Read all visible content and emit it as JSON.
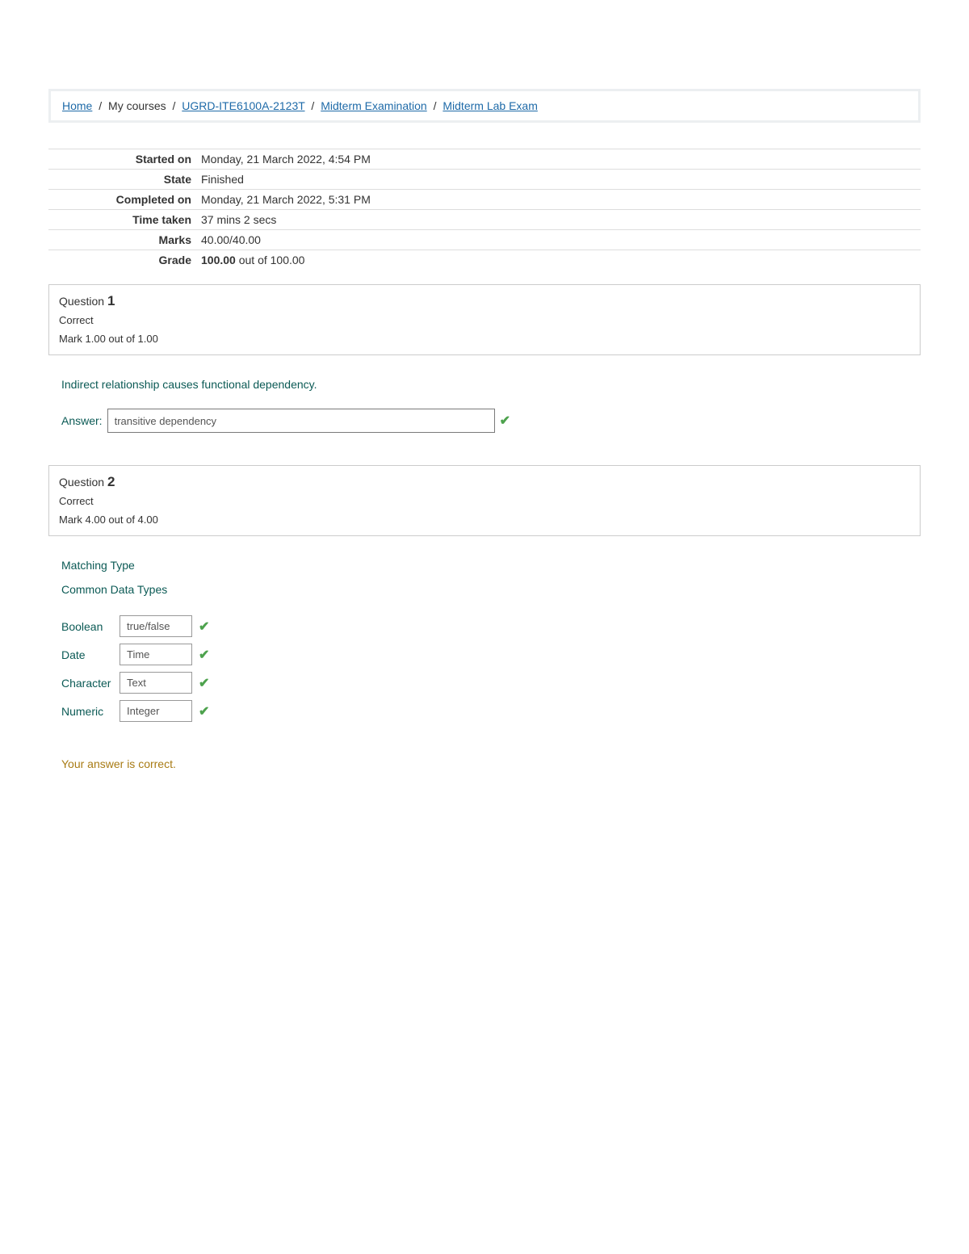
{
  "breadcrumb": {
    "home": "Home",
    "mycourses": "My courses",
    "course": "UGRD-ITE6100A-2123T",
    "section": "Midterm Examination",
    "activity": "Midterm Lab Exam"
  },
  "summary": {
    "started_on_label": "Started on",
    "started_on": "Monday, 21 March 2022, 4:54 PM",
    "state_label": "State",
    "state": "Finished",
    "completed_on_label": "Completed on",
    "completed_on": "Monday, 21 March 2022, 5:31 PM",
    "time_taken_label": "Time taken",
    "time_taken": "37 mins 2 secs",
    "marks_label": "Marks",
    "marks": "40.00/40.00",
    "grade_label": "Grade",
    "grade_bold": "100.00",
    "grade_rest": " out of 100.00"
  },
  "q1": {
    "question_word": "Question ",
    "number": "1",
    "status": "Correct",
    "mark": "Mark 1.00 out of 1.00",
    "prompt": "Indirect relationship causes functional dependency.",
    "answer_label": "Answer:",
    "answer_value": "transitive dependency"
  },
  "q2": {
    "question_word": "Question ",
    "number": "2",
    "status": "Correct",
    "mark": "Mark 4.00 out of 4.00",
    "title": "Matching Type",
    "subtitle": "Common Data Types",
    "rows": {
      "r0": {
        "label": "Boolean",
        "value": "true/false"
      },
      "r1": {
        "label": "Date",
        "value": "Time"
      },
      "r2": {
        "label": "Character",
        "value": "Text"
      },
      "r3": {
        "label": "Numeric",
        "value": "Integer"
      }
    },
    "feedback": "Your answer is correct."
  },
  "icons": {
    "check": "✔"
  }
}
